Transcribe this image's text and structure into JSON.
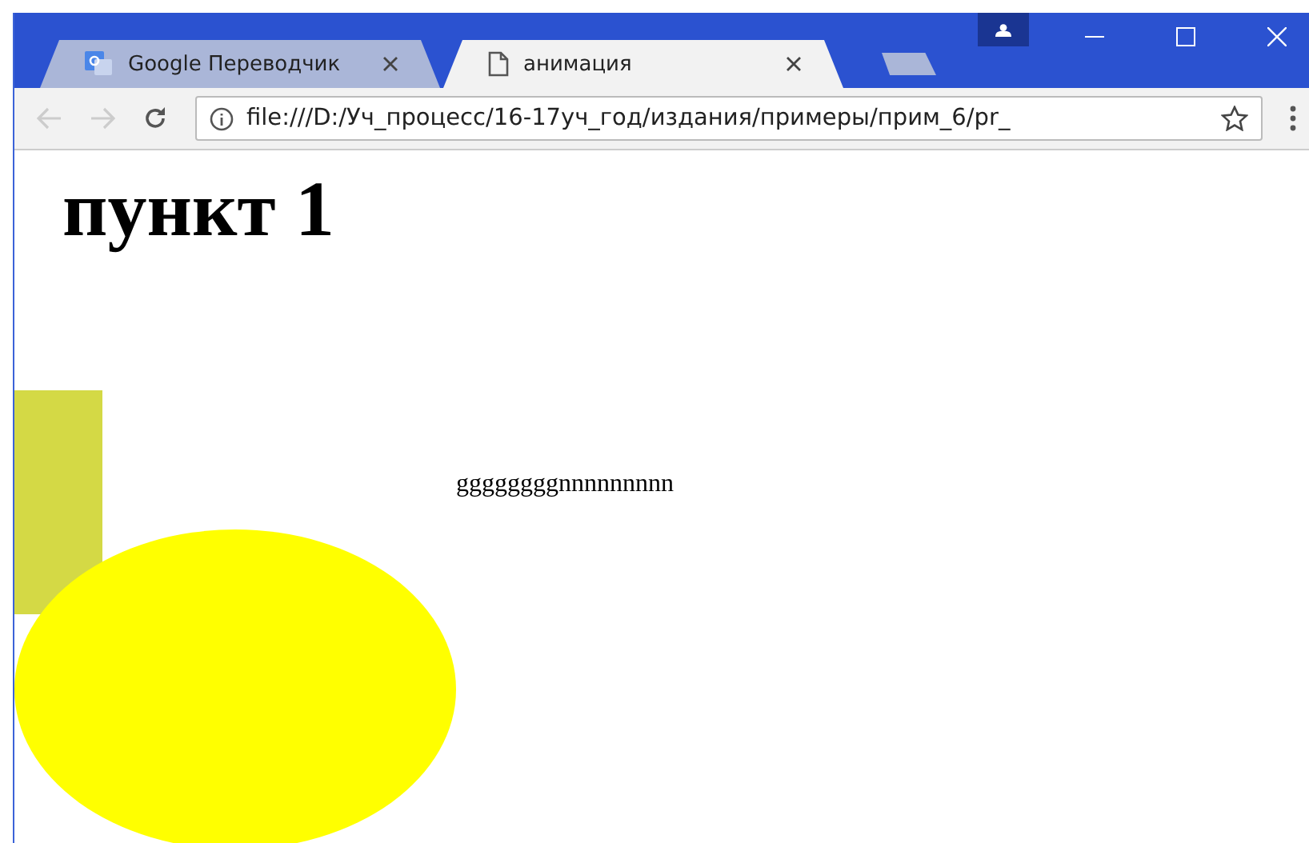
{
  "tabs": [
    {
      "title": "Google Переводчик",
      "selected": false,
      "kind": "translate"
    },
    {
      "title": "анимация",
      "selected": true,
      "kind": "page"
    }
  ],
  "address_bar": {
    "url": "file:///D:/Уч_процесс/16-17уч_год/издания/примеры/прим_6/pr_"
  },
  "page": {
    "heading": "пункт 1",
    "text": "ggggggggnnnnnnnnn"
  }
}
